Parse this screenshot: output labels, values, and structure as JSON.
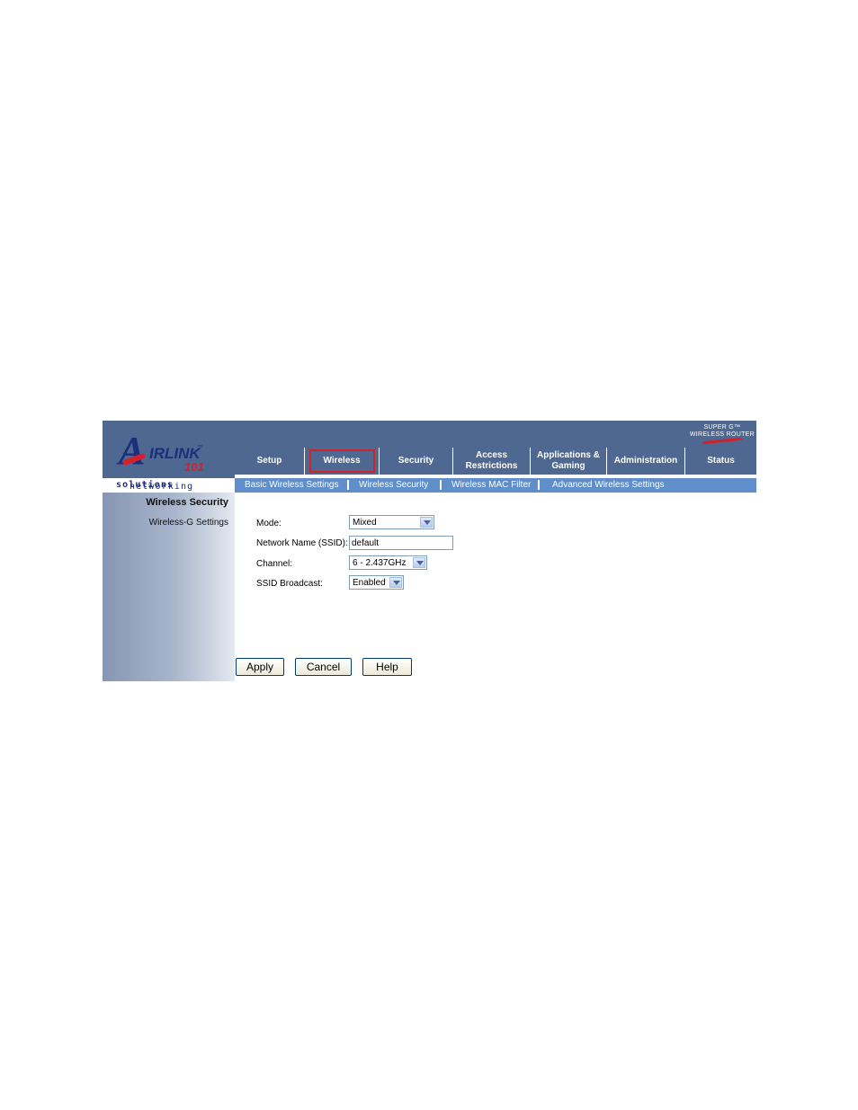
{
  "brand": {
    "logo_text": "AIRLINK",
    "logo_number": "101",
    "tagline_regular": "networking",
    "tagline_bold": "solutions",
    "product_line1": "SUPER G™",
    "product_line2": "WIRELESS ROUTER"
  },
  "tabs": [
    {
      "label": "Setup"
    },
    {
      "label": "Wireless"
    },
    {
      "label": "Security"
    },
    {
      "label": "Access Restrictions"
    },
    {
      "label": "Applications & Gaming"
    },
    {
      "label": "Administration"
    },
    {
      "label": "Status"
    }
  ],
  "active_tab": "Wireless",
  "subnav": [
    {
      "label": "Basic Wireless Settings"
    },
    {
      "label": "Wireless Security"
    },
    {
      "label": "Wireless MAC Filter"
    },
    {
      "label": "Advanced Wireless Settings"
    }
  ],
  "sidebar": {
    "section_title": "Wireless Security",
    "section_sub": "Wireless-G Settings"
  },
  "form": {
    "mode_label": "Mode:",
    "mode_value": "Mixed",
    "ssid_label": "Network Name (SSID):",
    "ssid_value": "default",
    "channel_label": "Channel:",
    "channel_value": "6 - 2.437GHz",
    "broadcast_label": "SSID Broadcast:",
    "broadcast_value": "Enabled"
  },
  "buttons": {
    "apply": "Apply",
    "cancel": "Cancel",
    "help": "Help"
  },
  "colors": {
    "header_bg": "#4e6891",
    "subnav_bg": "#5f8ecb",
    "highlight": "#d5202a"
  }
}
